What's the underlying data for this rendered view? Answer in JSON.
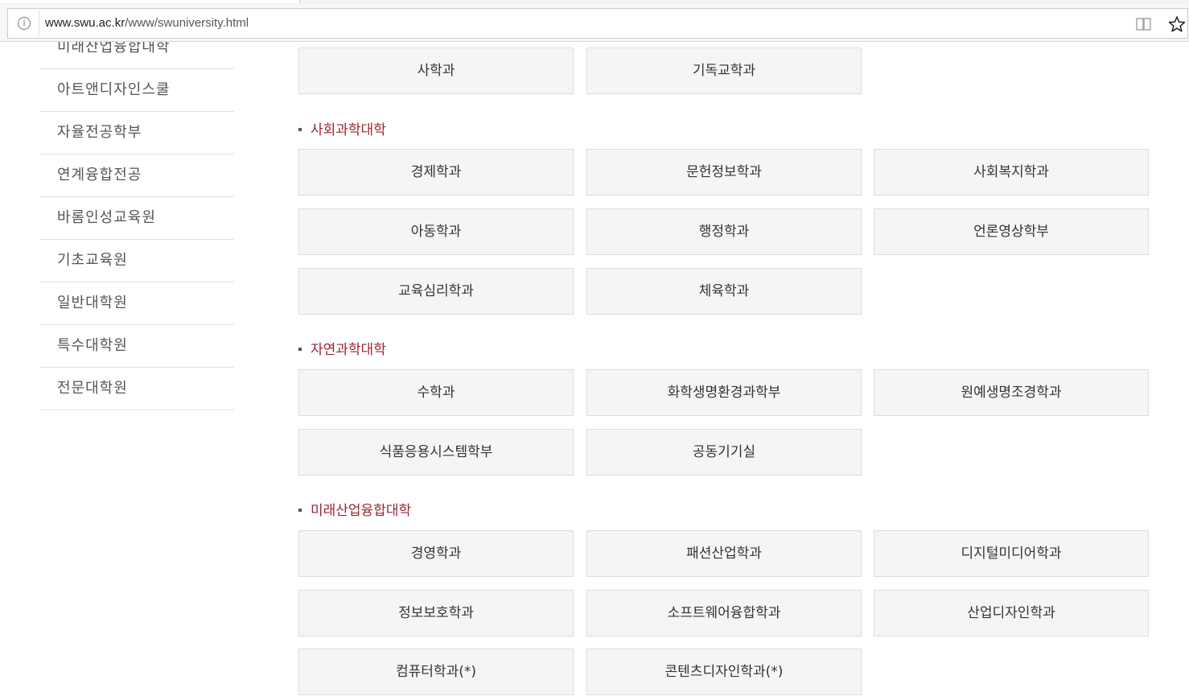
{
  "browser": {
    "url_host": "www.swu.ac.kr",
    "url_path": "/www/swuniversity.html",
    "info_icon": "info-icon",
    "reader_icon": "reader-mode-icon",
    "bookmark_icon": "star-icon"
  },
  "sidebar": {
    "items": [
      {
        "label": "미래산업융합대학"
      },
      {
        "label": "아트앤디자인스쿨"
      },
      {
        "label": "자율전공학부"
      },
      {
        "label": "연계융합전공"
      },
      {
        "label": "바롬인성교육원"
      },
      {
        "label": "기초교육원"
      },
      {
        "label": "일반대학원"
      },
      {
        "label": "특수대학원"
      },
      {
        "label": "전문대학원"
      }
    ]
  },
  "sections": [
    {
      "title": "",
      "departments": [
        "사학과",
        "기독교학과"
      ]
    },
    {
      "title": "사회과학대학",
      "departments": [
        "경제학과",
        "문헌정보학과",
        "사회복지학과",
        "아동학과",
        "행정학과",
        "언론영상학부",
        "교육심리학과",
        "체육학과"
      ]
    },
    {
      "title": "자연과학대학",
      "departments": [
        "수학과",
        "화학생명환경과학부",
        "원예생명조경학과",
        "식품응용시스템학부",
        "공동기기실"
      ]
    },
    {
      "title": "미래산업융합대학",
      "departments": [
        "경영학과",
        "패션산업학과",
        "디지털미디어학과",
        "정보보호학과",
        "소프트웨어융합학과",
        "산업디자인학과",
        "컴퓨터학과(*)",
        "콘텐츠디자인학과(*)"
      ]
    }
  ]
}
